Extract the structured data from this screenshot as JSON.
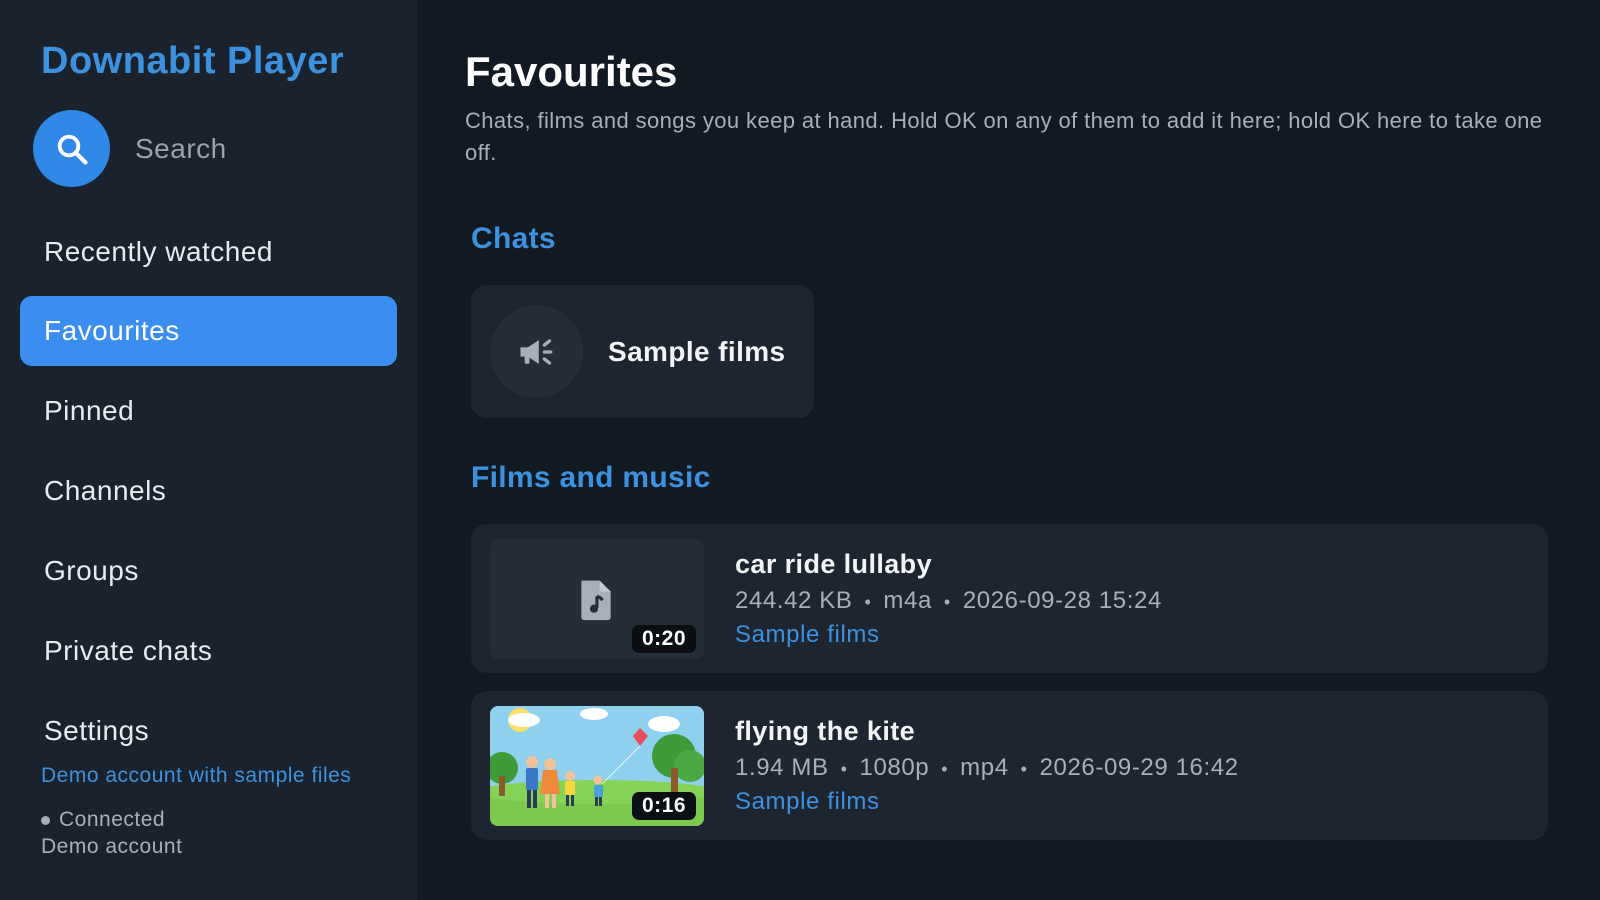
{
  "app": {
    "title": "Downabit Player"
  },
  "sidebar": {
    "search_label": "Search",
    "items": [
      {
        "label": "Recently watched",
        "active": false
      },
      {
        "label": "Favourites",
        "active": true
      },
      {
        "label": "Pinned",
        "active": false
      },
      {
        "label": "Channels",
        "active": false
      },
      {
        "label": "Groups",
        "active": false
      },
      {
        "label": "Private chats",
        "active": false
      },
      {
        "label": "Settings",
        "active": false
      }
    ],
    "account_link": "Demo account with sample files",
    "status": "Connected",
    "account_name": "Demo account"
  },
  "main": {
    "title": "Favourites",
    "description": "Chats, films and songs you keep at hand. Hold OK on any of them to add it here; hold OK here to take one off.",
    "chats_heading": "Chats",
    "chats": [
      {
        "name": "Sample films",
        "icon": "megaphone-icon"
      }
    ],
    "media_heading": "Films and music",
    "media": [
      {
        "title": "car ride lullaby",
        "meta": [
          "244.42 KB",
          "m4a",
          "2026-09-28 15:24"
        ],
        "chat": "Sample films",
        "duration": "0:20",
        "thumb": "audio-file-icon"
      },
      {
        "title": "flying the kite",
        "meta": [
          "1.94 MB",
          "1080p",
          "mp4",
          "2026-09-29 16:42"
        ],
        "chat": "Sample films",
        "duration": "0:16",
        "thumb": "kite-illustration"
      }
    ]
  },
  "colors": {
    "accent": "#3b8ef0",
    "link": "#3d92e0",
    "background": "#111922",
    "sidebar": "#1a222d",
    "card": "#1d2530"
  }
}
